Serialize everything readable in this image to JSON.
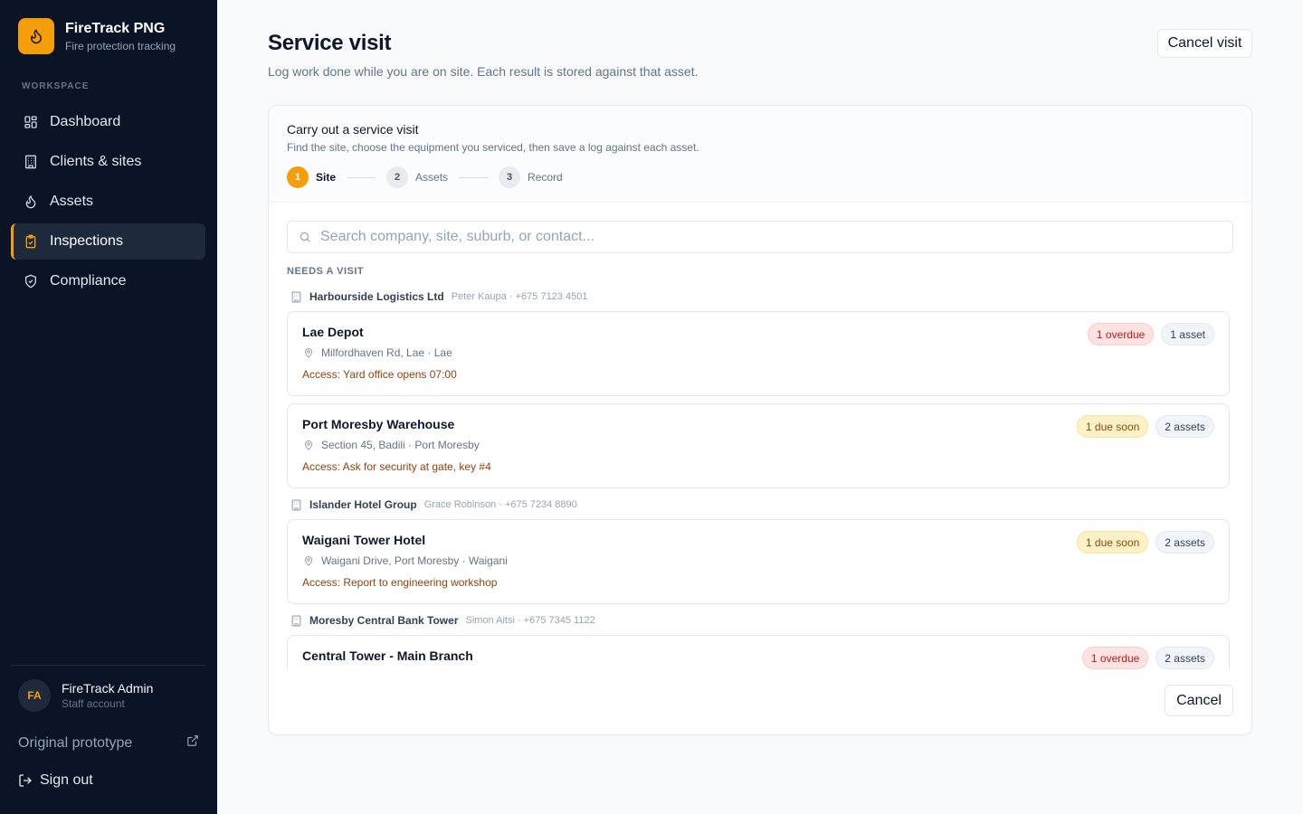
{
  "brand": {
    "name": "FireTrack PNG",
    "subtitle": "Fire protection tracking",
    "color": "#f59e0b"
  },
  "sidebar": {
    "section_label": "WORKSPACE",
    "items": [
      {
        "label": "Dashboard",
        "icon": "grid-icon",
        "active": false
      },
      {
        "label": "Clients & sites",
        "icon": "building-icon",
        "active": false
      },
      {
        "label": "Assets",
        "icon": "flame-icon",
        "active": false
      },
      {
        "label": "Inspections",
        "icon": "clipboard-check-icon",
        "active": true
      },
      {
        "label": "Compliance",
        "icon": "shield-check-icon",
        "active": false
      }
    ],
    "user": {
      "initials": "FA",
      "name": "FireTrack Admin",
      "role": "Staff account"
    },
    "prototype_link": "Original prototype",
    "sign_out": "Sign out"
  },
  "header": {
    "title": "Service visit",
    "subtitle": "Log work done while you are on site. Each result is stored against that asset.",
    "cancel_visit": "Cancel visit"
  },
  "card": {
    "title": "Carry out a service visit",
    "description": "Find the site, choose the equipment you serviced, then save a log against each asset.",
    "steps": [
      {
        "number": "1",
        "label": "Site",
        "active": true
      },
      {
        "number": "2",
        "label": "Assets",
        "active": false
      },
      {
        "number": "3",
        "label": "Record",
        "active": false
      }
    ],
    "search_placeholder": "Search company, site, suburb, or contact...",
    "section_label": "NEEDS A VISIT",
    "cancel": "Cancel"
  },
  "groups": [
    {
      "client": "Harbourside Logistics Ltd",
      "contact": "Peter Kaupa · +675 7123 4501",
      "sites": [
        {
          "name": "Lae Depot",
          "address": "Milfordhaven Rd, Lae · Lae",
          "access": "Access: Yard office opens 07:00",
          "status": "1 overdue",
          "status_type": "overdue",
          "assets": "1 asset"
        },
        {
          "name": "Port Moresby Warehouse",
          "address": "Section 45, Badili · Port Moresby",
          "access": "Access: Ask for security at gate, key #4",
          "status": "1 due soon",
          "status_type": "soon",
          "assets": "2 assets"
        }
      ]
    },
    {
      "client": "Islander Hotel Group",
      "contact": "Grace Robinson · +675 7234 8890",
      "sites": [
        {
          "name": "Waigani Tower Hotel",
          "address": "Waigani Drive, Port Moresby · Waigani",
          "access": "Access: Report to engineering workshop",
          "status": "1 due soon",
          "status_type": "soon",
          "assets": "2 assets"
        }
      ]
    },
    {
      "client": "Moresby Central Bank Tower",
      "contact": "Simon Aitsi · +675 7345 1122",
      "sites": [
        {
          "name": "Central Tower - Main Branch",
          "address": "",
          "access": "",
          "status": "1 overdue",
          "status_type": "overdue",
          "assets": "2 assets"
        }
      ]
    }
  ]
}
